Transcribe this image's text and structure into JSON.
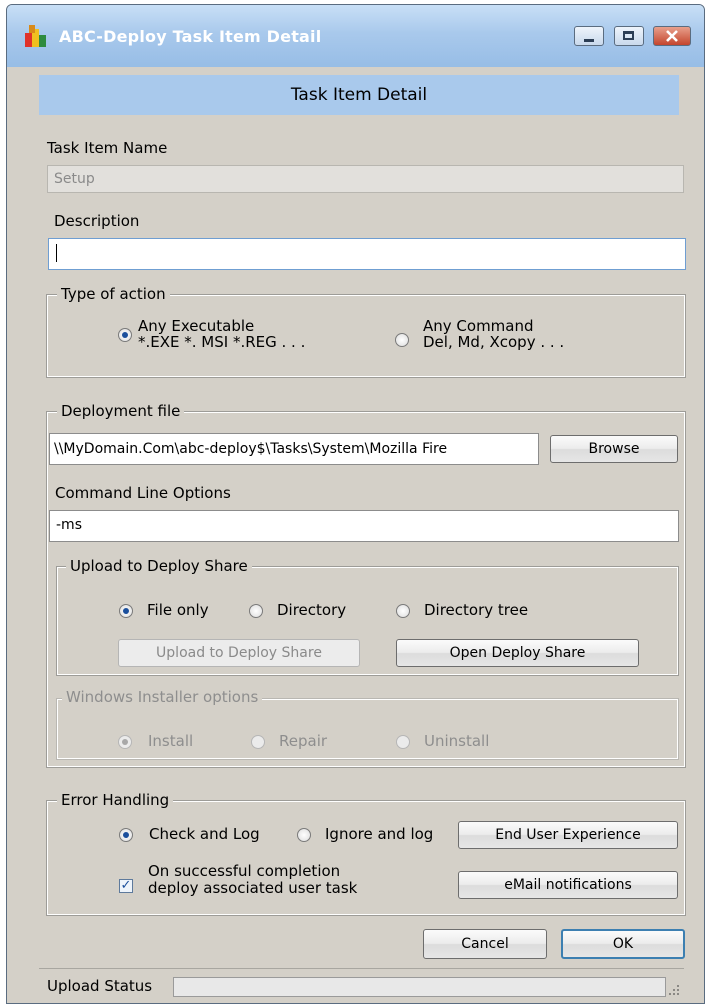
{
  "window": {
    "title": "ABC-Deploy  Task Item Detail",
    "controls": {
      "minimize": "minimize-icon",
      "maximize": "maximize-icon",
      "close": "close-icon"
    }
  },
  "header": {
    "title": "Task Item Detail"
  },
  "task_item_name": {
    "label": "Task Item Name",
    "value": "Setup"
  },
  "description": {
    "label": "Description",
    "value": ""
  },
  "type_of_action": {
    "legend": "Type of action",
    "options": [
      {
        "line1": "Any Executable",
        "line2": "*.EXE  *. MSI  *.REG  . . .",
        "selected": true
      },
      {
        "line1": "Any Command",
        "line2": "Del,  Md,  Xcopy . . .",
        "selected": false
      }
    ]
  },
  "deployment": {
    "legend": "Deployment file",
    "file_path": "\\\\MyDomain.Com\\abc-deploy$\\Tasks\\System\\Mozilla Fire",
    "browse_label": "Browse",
    "cmd_label": "Command Line Options",
    "cmd_value": "-ms",
    "upload": {
      "legend": "Upload to Deploy Share",
      "options": [
        "File only",
        "Directory",
        "Directory tree"
      ],
      "selected_index": 0,
      "upload_button": "Upload to Deploy Share",
      "open_button": "Open Deploy Share"
    },
    "installer": {
      "legend": "Windows Installer options",
      "options": [
        "Install",
        "Repair",
        "Uninstall"
      ],
      "selected_index": 0
    }
  },
  "error_handling": {
    "legend": "Error Handling",
    "options": [
      "Check and Log",
      "Ignore and log"
    ],
    "selected_index": 0,
    "end_user_button": "End User Experience",
    "checkbox_line1": "On successful completion",
    "checkbox_line2": "deploy associated user task",
    "checkbox_checked": true,
    "email_button": "eMail notifications"
  },
  "footer": {
    "cancel_label": "Cancel",
    "ok_label": "OK",
    "status_label": "Upload Status",
    "progress": 0
  }
}
